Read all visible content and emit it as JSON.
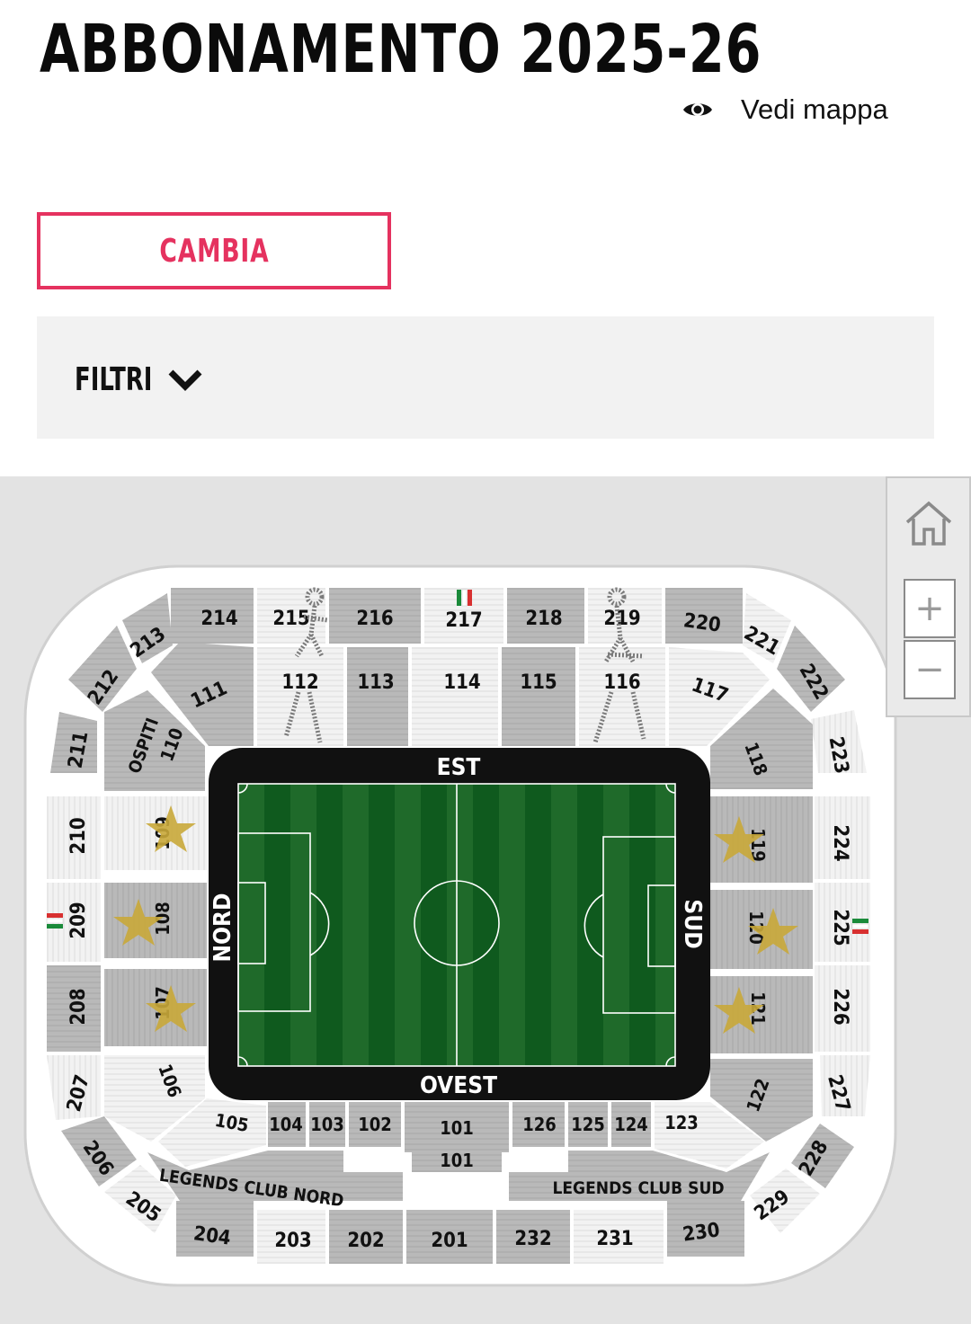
{
  "header": {
    "title": "ABBONAMENTO 2025-26",
    "view_map_label": "Vedi mappa",
    "view_map_icon": "eye-icon"
  },
  "change_button": {
    "label": "CAMBIA",
    "color": "#e5325f"
  },
  "filters": {
    "label": "FILTRI",
    "icon": "chevron-down-icon"
  },
  "map_controls": {
    "home_icon": "home-icon",
    "zoom_in_label": "+",
    "zoom_out_label": "−"
  },
  "stadium": {
    "sides": {
      "east": "EST",
      "west": "OVEST",
      "north": "NORD",
      "south": "SUD"
    },
    "guest_label": "OSPITI",
    "legends_nord": "LEGENDS CLUB NORD",
    "legends_sud": "LEGENDS CLUB SUD",
    "colors": {
      "sector": "#b9b9b9",
      "sector_light": "#f1f1f1",
      "star": "#c9a83a",
      "frame": "#111111"
    },
    "sectors": {
      "s214": "214",
      "s215": "215",
      "s216": "216",
      "s217": "217",
      "s218": "218",
      "s219": "219",
      "s220": "220",
      "s221": "221",
      "s213": "213",
      "s212": "212",
      "s211": "211",
      "s210": "210",
      "s209": "209",
      "s208": "208",
      "s207": "207",
      "s206": "206",
      "s205": "205",
      "s204": "204",
      "s203": "203",
      "s202": "202",
      "s201": "201",
      "s232": "232",
      "s231": "231",
      "s230": "230",
      "s229": "229",
      "s228": "228",
      "s227": "227",
      "s226": "226",
      "s225": "225",
      "s224": "224",
      "s223": "223",
      "s222": "222",
      "s111": "111",
      "s112": "112",
      "s113": "113",
      "s114": "114",
      "s115": "115",
      "s116": "116",
      "s117": "117",
      "s118": "118",
      "s119": "119",
      "s120": "120",
      "s121": "121",
      "s122": "122",
      "s123": "123",
      "s124": "124",
      "s125": "125",
      "s126": "126",
      "s101": "101",
      "s101b": "101",
      "s102": "102",
      "s103": "103",
      "s104": "104",
      "s105": "105",
      "s106": "106",
      "s107": "107",
      "s108": "108",
      "s109": "109",
      "s110": "110"
    }
  }
}
